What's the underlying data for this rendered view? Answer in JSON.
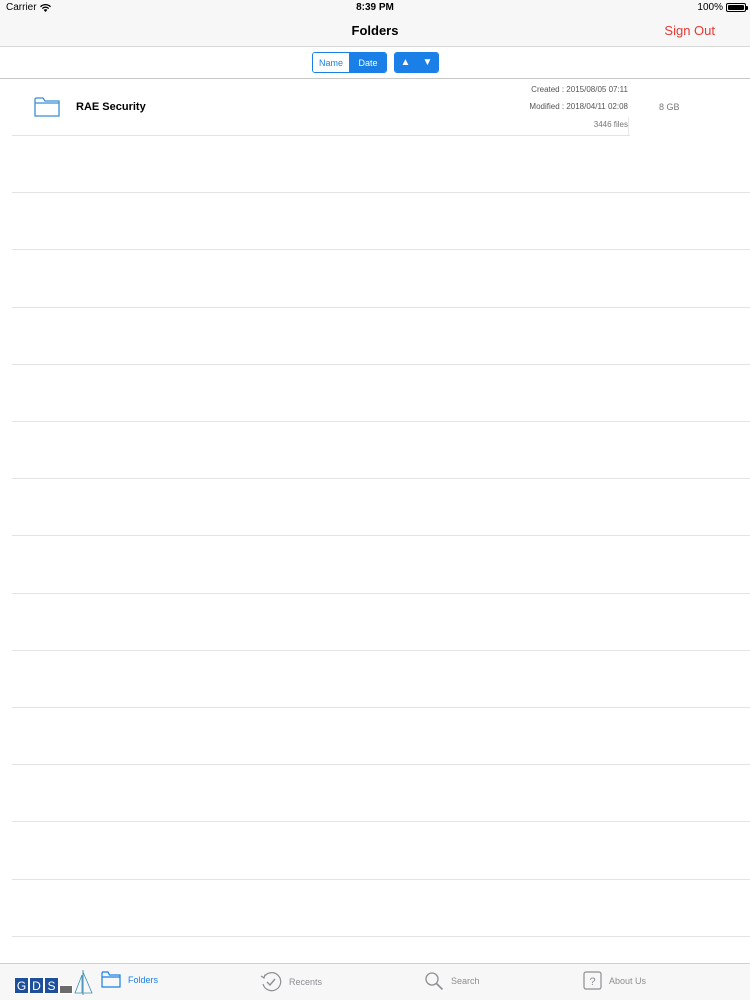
{
  "status_bar": {
    "carrier": "Carrier",
    "time": "8:39 PM",
    "battery": "100%"
  },
  "nav": {
    "title": "Folders",
    "sign_out": "Sign Out"
  },
  "sort": {
    "key_options": [
      {
        "label": "Name",
        "selected": false
      },
      {
        "label": "Date",
        "selected": true
      }
    ],
    "direction_up": "▲",
    "direction_down": "▼"
  },
  "folders": [
    {
      "name": "RAE Security",
      "created": "Created : 2015/08/05 07:11",
      "modified": "Modified : 2018/04/11 02:08",
      "file_count": "3446 files",
      "size": "8 GB"
    }
  ],
  "tab_bar": {
    "logo_text": "G D S",
    "tabs": [
      {
        "label": "Folders",
        "icon": "folder-icon",
        "active": true
      },
      {
        "label": "Recents",
        "icon": "recents-clock-icon",
        "active": false
      },
      {
        "label": "Search",
        "icon": "search-icon",
        "active": false
      },
      {
        "label": "About Us",
        "icon": "question-icon",
        "active": false
      }
    ]
  },
  "colors": {
    "accent": "#1a7fe6",
    "sign_out": "#e53935",
    "bar_background": "#f7f7f7"
  }
}
